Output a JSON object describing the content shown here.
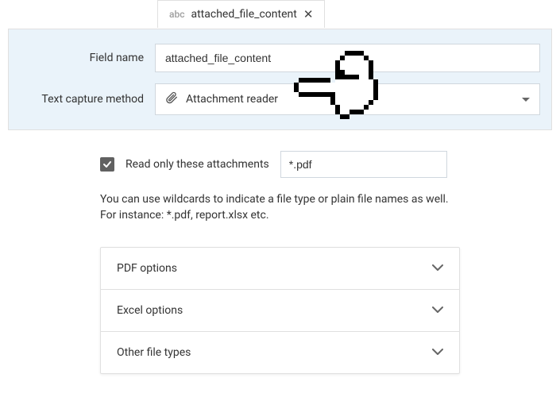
{
  "tab": {
    "type_label": "abc",
    "title": "attached_file_content"
  },
  "header": {
    "field_name_label": "Field name",
    "field_name_value": "attached_file_content",
    "capture_label": "Text capture method",
    "capture_value": "Attachment reader"
  },
  "attachments_filter": {
    "checkbox_label": "Read only these attachments",
    "checked": true,
    "pattern_value": "*.pdf"
  },
  "hint_text": "You can use wildcards to indicate a file type or plain file names as well. For instance: *.pdf, report.xlsx etc.",
  "accordion": {
    "items": [
      {
        "label": "PDF options"
      },
      {
        "label": "Excel options"
      },
      {
        "label": "Other file types"
      }
    ]
  }
}
